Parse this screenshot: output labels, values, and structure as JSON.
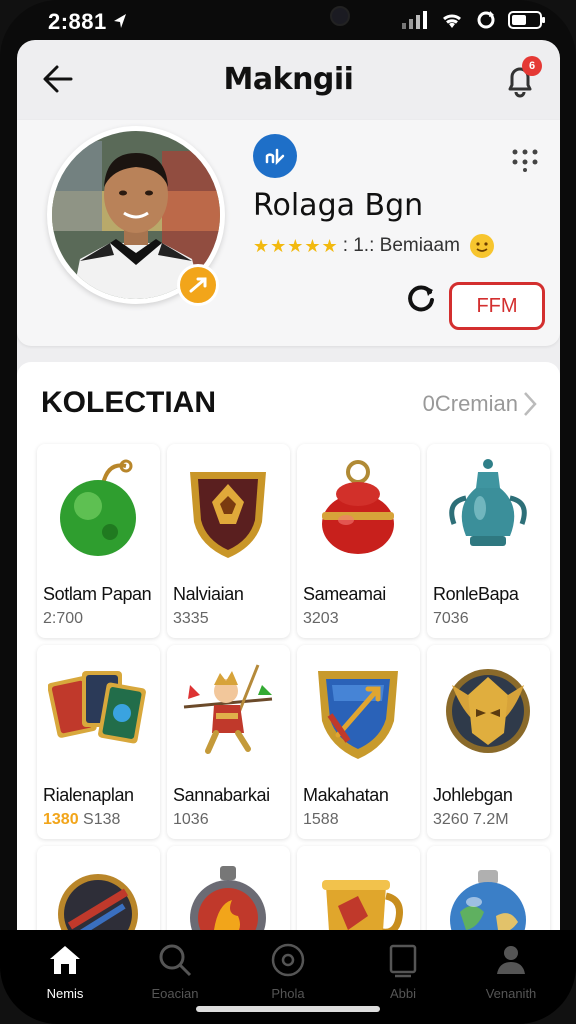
{
  "status_bar": {
    "time": "2:881",
    "time_separator": ""
  },
  "header": {
    "title": "Makngii",
    "notifications_count": "6"
  },
  "profile": {
    "name": "Rolaga Bgn",
    "stars": "★★★★★",
    "rating_text": ": 1.: Bemiaam",
    "follow_label": "FFM"
  },
  "collection": {
    "title": "KOLECTIAN",
    "see_all_label": "0Cremian",
    "items": [
      {
        "name": "Sotlam Papan",
        "value": "2:700",
        "icon": "green-orb-icon"
      },
      {
        "name": "Nalviaian",
        "value": "3335",
        "icon": "shield-emblem-icon"
      },
      {
        "name": "Sameamai",
        "value": "3203",
        "icon": "red-pot-icon"
      },
      {
        "name": "RonleBapa",
        "value": "7036",
        "icon": "teal-jug-icon"
      },
      {
        "name": "Rialenaplan",
        "value_highlight": "1380",
        "value": "S138",
        "icon": "cards-icon"
      },
      {
        "name": "Sannabarkai",
        "value": "1036",
        "icon": "warrior-figure-icon"
      },
      {
        "name": "Makahatan",
        "value": "1588",
        "icon": "blue-shield-icon"
      },
      {
        "name": "Johlebgan",
        "value": "3260 7.2M",
        "icon": "golden-helmet-icon"
      },
      {
        "name": "",
        "value": "",
        "icon": "dark-shield-icon"
      },
      {
        "name": "",
        "value": "",
        "icon": "fire-medallion-icon"
      },
      {
        "name": "",
        "value": "",
        "icon": "gold-goblet-icon"
      },
      {
        "name": "",
        "value": "",
        "icon": "globe-vase-icon"
      }
    ]
  },
  "tabbar": {
    "tabs": [
      {
        "label": "Nemis",
        "icon": "home-icon",
        "active": true
      },
      {
        "label": "Eoacian",
        "icon": "search-icon",
        "active": false
      },
      {
        "label": "Phola",
        "icon": "record-icon",
        "active": false
      },
      {
        "label": "Abbi",
        "icon": "square-icon",
        "active": false
      },
      {
        "label": "Venanith",
        "icon": "user-icon",
        "active": false
      }
    ]
  },
  "colors": {
    "accent": "#d32f2f",
    "star": "#f2b90f",
    "badge": "#f2a51a",
    "app_badge": "#1e6fc8"
  }
}
